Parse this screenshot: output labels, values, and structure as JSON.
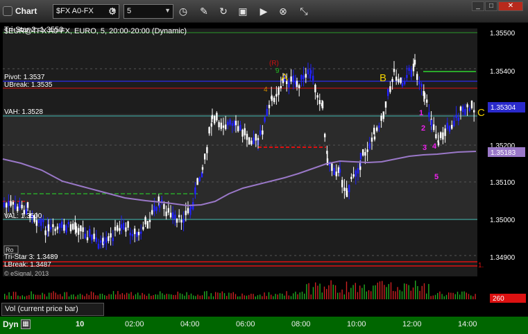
{
  "window": {
    "title": "Chart",
    "symbol": "$FX A0-FX",
    "interval": "5",
    "minimize": "_",
    "maximize": "□",
    "close": "✕"
  },
  "toolbar": {
    "settings_icon": "gear-icon",
    "clock_icon": "clock-icon",
    "pencil_icon": "pencil-icon",
    "refresh_icon": "refresh-icon",
    "study_icon": "indicator-icon",
    "play_icon": "play-icon",
    "cancel_icon": "cancel-icon",
    "link_icon": "link-icon"
  },
  "chart": {
    "header": "$EUR@TFX A0-FX, EURO, 5, 20:00-20:00 (Dynamic)",
    "watermark": "© eSignal, 2013",
    "labels": {
      "tristar2": "Tri-Star 2: 1.3550",
      "pivot": "Pivot: 1.3537",
      "ubreak": "UBreak: 1.3535",
      "vah": "VAH: 1.3528",
      "val": "VAL: 1.3500",
      "tristar3": "Tri-Star 3: 1.3489",
      "lbreak": "LBreak: 1.3487",
      "ro": "Ro"
    },
    "annotations": {
      "a": "A",
      "b": "B",
      "c": "C",
      "r": "(R)",
      "n9": "9",
      "n4": "4",
      "m1": "1",
      "m2": "2",
      "m3": "3",
      "m4": "4",
      "m5": "5"
    },
    "price_axis": [
      "1.35500",
      "1.35400",
      "1.35304",
      "1.35200",
      "1.35183",
      "1.35100",
      "1.35000",
      "1.34900"
    ],
    "axis_marker": "1.",
    "vol_axis": "260"
  },
  "colors": {
    "background": "#000000",
    "chart_panel": "#1f1f1f",
    "up_bar": "#ffffff",
    "down_bar": "#2222ff",
    "vah_line": "#3fb8b0",
    "red_line": "#dd1111",
    "ubreak_line": "#2222cc",
    "tristar_line": "#2a9a2a",
    "ma_line": "#9a78c8",
    "accent_yellow": "#f0d000",
    "magenta": "#ee22ee",
    "bottom_bar": "#006600"
  },
  "volume": {
    "label": "Vol (current price bar)"
  },
  "footer": {
    "mode": "Dyn",
    "mode_icon": "grid-icon",
    "date_tick": "10",
    "time_ticks": [
      "02:00",
      "04:00",
      "06:00",
      "08:00",
      "10:00",
      "12:00",
      "14:00"
    ]
  }
}
